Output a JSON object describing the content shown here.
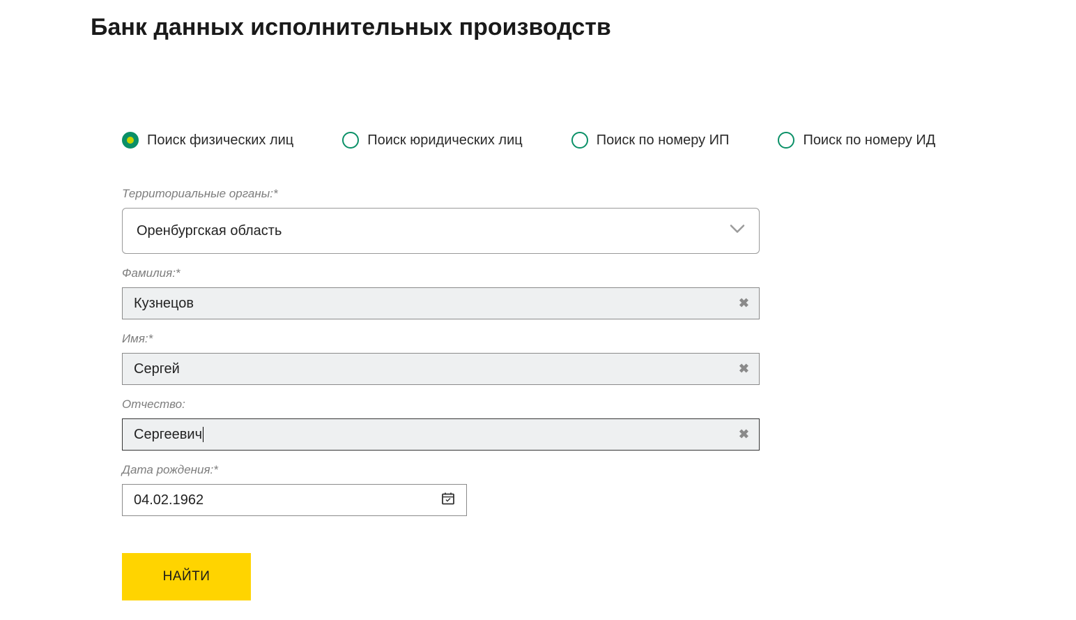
{
  "title": "Банк данных исполнительных производств",
  "tabs": [
    {
      "label": "Поиск физических лиц",
      "selected": true
    },
    {
      "label": "Поиск юридических лиц",
      "selected": false
    },
    {
      "label": "Поиск по номеру ИП",
      "selected": false
    },
    {
      "label": "Поиск по номеру ИД",
      "selected": false
    }
  ],
  "form": {
    "region": {
      "label": "Территориальные органы:*",
      "value": "Оренбургская область"
    },
    "surname": {
      "label": "Фамилия:*",
      "value": "Кузнецов"
    },
    "firstname": {
      "label": "Имя:*",
      "value": "Сергей"
    },
    "patronymic": {
      "label": "Отчество:",
      "value": "Сергеевич"
    },
    "birthdate": {
      "label": "Дата рождения:*",
      "value": "04.02.1962"
    },
    "submit": "НАЙТИ"
  }
}
